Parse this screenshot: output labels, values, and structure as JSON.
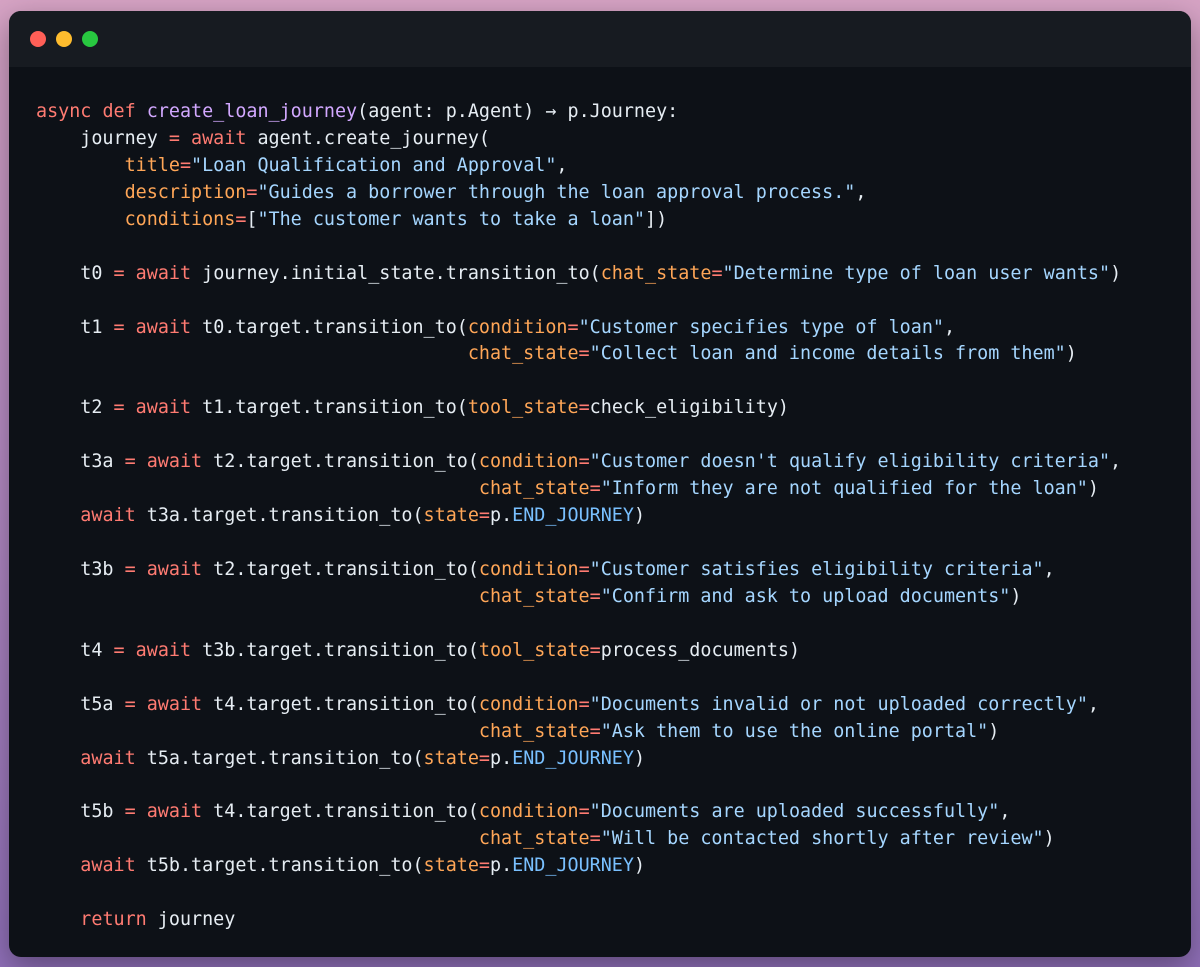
{
  "window": {
    "controls": {
      "close_color": "#ff5f57",
      "minimize_color": "#febc2e",
      "maximize_color": "#28c840"
    }
  },
  "theme": {
    "background": "#0d1117",
    "titlebar": "#171b21",
    "keyword": "#ff7b72",
    "function": "#d2a8ff",
    "parameter": "#ffa657",
    "string": "#a5d6ff",
    "constant": "#79c0ff",
    "text": "#e6edf3"
  },
  "code": {
    "lines": [
      [
        [
          "kw",
          "async"
        ],
        [
          "plain",
          " "
        ],
        [
          "kw",
          "def"
        ],
        [
          "plain",
          " "
        ],
        [
          "fn",
          "create_loan_journey"
        ],
        [
          "plain",
          "(agent: p.Agent) → p.Journey:"
        ]
      ],
      [
        [
          "plain",
          "    journey "
        ],
        [
          "op",
          "="
        ],
        [
          "plain",
          " "
        ],
        [
          "kw",
          "await"
        ],
        [
          "plain",
          " agent.create_journey("
        ]
      ],
      [
        [
          "plain",
          "        "
        ],
        [
          "param",
          "title"
        ],
        [
          "op",
          "="
        ],
        [
          "str",
          "\"Loan Qualification and Approval\""
        ],
        [
          "plain",
          ","
        ]
      ],
      [
        [
          "plain",
          "        "
        ],
        [
          "param",
          "description"
        ],
        [
          "op",
          "="
        ],
        [
          "str",
          "\"Guides a borrower through the loan approval process.\""
        ],
        [
          "plain",
          ","
        ]
      ],
      [
        [
          "plain",
          "        "
        ],
        [
          "param",
          "conditions"
        ],
        [
          "op",
          "="
        ],
        [
          "plain",
          "["
        ],
        [
          "str",
          "\"The customer wants to take a loan\""
        ],
        [
          "plain",
          "])"
        ]
      ],
      [],
      [
        [
          "plain",
          "    t0 "
        ],
        [
          "op",
          "="
        ],
        [
          "plain",
          " "
        ],
        [
          "kw",
          "await"
        ],
        [
          "plain",
          " journey.initial_state.transition_to("
        ],
        [
          "param",
          "chat_state"
        ],
        [
          "op",
          "="
        ],
        [
          "str",
          "\"Determine type of loan user wants\""
        ],
        [
          "plain",
          ")"
        ]
      ],
      [],
      [
        [
          "plain",
          "    t1 "
        ],
        [
          "op",
          "="
        ],
        [
          "plain",
          " "
        ],
        [
          "kw",
          "await"
        ],
        [
          "plain",
          " t0.target.transition_to("
        ],
        [
          "param",
          "condition"
        ],
        [
          "op",
          "="
        ],
        [
          "str",
          "\"Customer specifies type of loan\""
        ],
        [
          "plain",
          ","
        ]
      ],
      [
        [
          "plain",
          "                                       "
        ],
        [
          "param",
          "chat_state"
        ],
        [
          "op",
          "="
        ],
        [
          "str",
          "\"Collect loan and income details from them\""
        ],
        [
          "plain",
          ")"
        ]
      ],
      [],
      [
        [
          "plain",
          "    t2 "
        ],
        [
          "op",
          "="
        ],
        [
          "plain",
          " "
        ],
        [
          "kw",
          "await"
        ],
        [
          "plain",
          " t1.target.transition_to("
        ],
        [
          "param",
          "tool_state"
        ],
        [
          "op",
          "="
        ],
        [
          "plain",
          "check_eligibility)"
        ]
      ],
      [],
      [
        [
          "plain",
          "    t3a "
        ],
        [
          "op",
          "="
        ],
        [
          "plain",
          " "
        ],
        [
          "kw",
          "await"
        ],
        [
          "plain",
          " t2.target.transition_to("
        ],
        [
          "param",
          "condition"
        ],
        [
          "op",
          "="
        ],
        [
          "str",
          "\"Customer doesn't qualify eligibility criteria\""
        ],
        [
          "plain",
          ","
        ]
      ],
      [
        [
          "plain",
          "                                        "
        ],
        [
          "param",
          "chat_state"
        ],
        [
          "op",
          "="
        ],
        [
          "str",
          "\"Inform they are not qualified for the loan\""
        ],
        [
          "plain",
          ")"
        ]
      ],
      [
        [
          "plain",
          "    "
        ],
        [
          "kw",
          "await"
        ],
        [
          "plain",
          " t3a.target.transition_to("
        ],
        [
          "param",
          "state"
        ],
        [
          "op",
          "="
        ],
        [
          "plain",
          "p."
        ],
        [
          "const",
          "END_JOURNEY"
        ],
        [
          "plain",
          ")"
        ]
      ],
      [],
      [
        [
          "plain",
          "    t3b "
        ],
        [
          "op",
          "="
        ],
        [
          "plain",
          " "
        ],
        [
          "kw",
          "await"
        ],
        [
          "plain",
          " t2.target.transition_to("
        ],
        [
          "param",
          "condition"
        ],
        [
          "op",
          "="
        ],
        [
          "str",
          "\"Customer satisfies eligibility criteria\""
        ],
        [
          "plain",
          ","
        ]
      ],
      [
        [
          "plain",
          "                                        "
        ],
        [
          "param",
          "chat_state"
        ],
        [
          "op",
          "="
        ],
        [
          "str",
          "\"Confirm and ask to upload documents\""
        ],
        [
          "plain",
          ")"
        ]
      ],
      [],
      [
        [
          "plain",
          "    t4 "
        ],
        [
          "op",
          "="
        ],
        [
          "plain",
          " "
        ],
        [
          "kw",
          "await"
        ],
        [
          "plain",
          " t3b.target.transition_to("
        ],
        [
          "param",
          "tool_state"
        ],
        [
          "op",
          "="
        ],
        [
          "plain",
          "process_documents)"
        ]
      ],
      [],
      [
        [
          "plain",
          "    t5a "
        ],
        [
          "op",
          "="
        ],
        [
          "plain",
          " "
        ],
        [
          "kw",
          "await"
        ],
        [
          "plain",
          " t4.target.transition_to("
        ],
        [
          "param",
          "condition"
        ],
        [
          "op",
          "="
        ],
        [
          "str",
          "\"Documents invalid or not uploaded correctly\""
        ],
        [
          "plain",
          ","
        ]
      ],
      [
        [
          "plain",
          "                                        "
        ],
        [
          "param",
          "chat_state"
        ],
        [
          "op",
          "="
        ],
        [
          "str",
          "\"Ask them to use the online portal\""
        ],
        [
          "plain",
          ")"
        ]
      ],
      [
        [
          "plain",
          "    "
        ],
        [
          "kw",
          "await"
        ],
        [
          "plain",
          " t5a.target.transition_to("
        ],
        [
          "param",
          "state"
        ],
        [
          "op",
          "="
        ],
        [
          "plain",
          "p."
        ],
        [
          "const",
          "END_JOURNEY"
        ],
        [
          "plain",
          ")"
        ]
      ],
      [],
      [
        [
          "plain",
          "    t5b "
        ],
        [
          "op",
          "="
        ],
        [
          "plain",
          " "
        ],
        [
          "kw",
          "await"
        ],
        [
          "plain",
          " t4.target.transition_to("
        ],
        [
          "param",
          "condition"
        ],
        [
          "op",
          "="
        ],
        [
          "str",
          "\"Documents are uploaded successfully\""
        ],
        [
          "plain",
          ","
        ]
      ],
      [
        [
          "plain",
          "                                        "
        ],
        [
          "param",
          "chat_state"
        ],
        [
          "op",
          "="
        ],
        [
          "str",
          "\"Will be contacted shortly after review\""
        ],
        [
          "plain",
          ")"
        ]
      ],
      [
        [
          "plain",
          "    "
        ],
        [
          "kw",
          "await"
        ],
        [
          "plain",
          " t5b.target.transition_to("
        ],
        [
          "param",
          "state"
        ],
        [
          "op",
          "="
        ],
        [
          "plain",
          "p."
        ],
        [
          "const",
          "END_JOURNEY"
        ],
        [
          "plain",
          ")"
        ]
      ],
      [],
      [
        [
          "plain",
          "    "
        ],
        [
          "kw",
          "return"
        ],
        [
          "plain",
          " journey"
        ]
      ]
    ]
  }
}
